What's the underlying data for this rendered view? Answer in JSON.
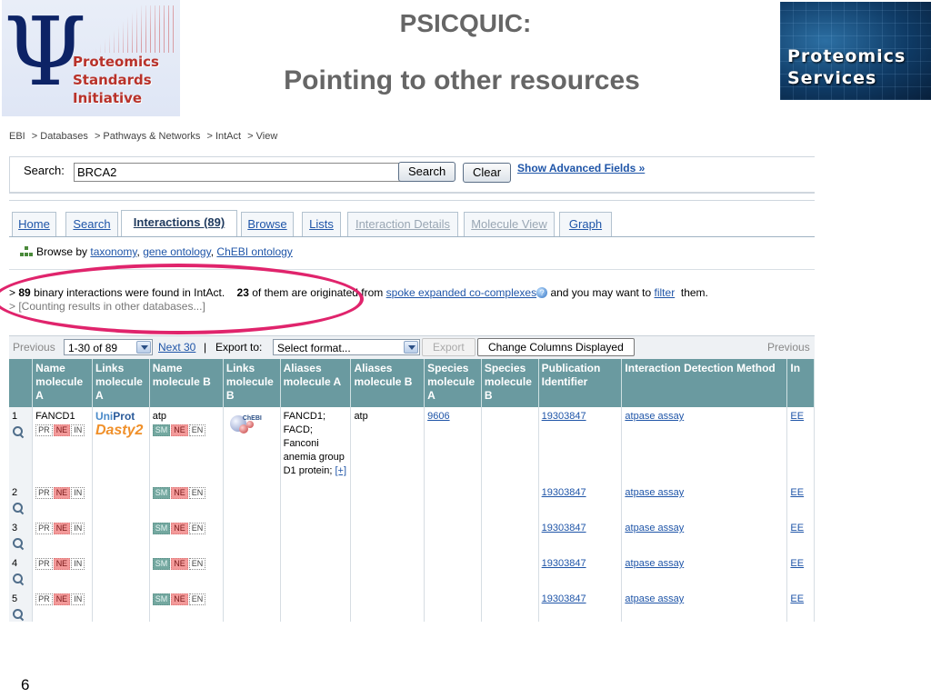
{
  "slide": {
    "title_line1": "PSICQUIC:",
    "title_line2": "Pointing to other resources",
    "number": "6",
    "logo_left_text": [
      "Proteomics",
      "Standards",
      "Initiative"
    ],
    "logo_left_symbol": "Ψ",
    "logo_right_text": [
      "Proteomics",
      "Services"
    ]
  },
  "breadcrumb": [
    "EBI",
    "> Databases",
    "> Pathways & Networks",
    "> IntAct",
    "> View"
  ],
  "search": {
    "label": "Search:",
    "value": "BRCA2",
    "search_button": "Search",
    "clear_button": "Clear",
    "advanced_link": "Show Advanced Fields »"
  },
  "tabs": [
    {
      "label": "Home"
    },
    {
      "label": "Search"
    },
    {
      "label": "Interactions (89)"
    },
    {
      "label": "Browse"
    },
    {
      "label": "Lists"
    },
    {
      "label": "Interaction Details"
    },
    {
      "label": "Molecule View"
    },
    {
      "label": "Graph"
    }
  ],
  "browse_by": {
    "prefix": "Browse by",
    "link1": "taxonomy",
    "sep1": ",",
    "link2": "gene ontology",
    "sep2": ",",
    "link3": "ChEBI ontology"
  },
  "info": {
    "gt": ">",
    "count": "89",
    "text1": "binary interactions were found in IntAct.",
    "count2": "23",
    "text2": "of them are originated from",
    "link_spoke": "spoke expanded co-complexes",
    "help_glyph": "?",
    "text3": "and you may want to",
    "link_filter": "filter",
    "text4": "them.",
    "line2": "> [Counting results in other databases...]"
  },
  "pager": {
    "previous": "Previous",
    "range": "1-30 of 89",
    "next": "Next 30",
    "sep": "|",
    "export_label": "Export to:",
    "export_select": "Select format...",
    "export_button": "Export",
    "change_columns": "Change Columns Displayed",
    "previous_right": "Previous"
  },
  "table": {
    "headers": [
      "",
      "Name molecule A",
      "Links molecule A",
      "Name molecule B",
      "Links molecule B",
      "Aliases molecule A",
      "Aliases molecule B",
      "Species molecule A",
      "Species molecule B",
      "Publication Identifier",
      "Interaction Detection Method",
      "In"
    ],
    "tags": {
      "pr": "PR",
      "ne": "NE",
      "in": "IN",
      "sm": "SM",
      "en": "EN"
    },
    "logos": {
      "uniprot_a": "Uni",
      "uniprot_b": "Prot",
      "dasty": "Dasty",
      "dasty_num": "2",
      "chebi": "ChEBI"
    },
    "rows": [
      {
        "num": "1",
        "name_a": "FANCD1",
        "name_b": "atp",
        "aliases_a": "FANCD1; FACD; Fanconi anemia group D1 protein;",
        "aliases_more": "[+]",
        "aliases_b": "atp",
        "species_a": "9606",
        "species_b": "",
        "pub": "19303847",
        "method": "atpase assay",
        "next": "EE"
      },
      {
        "num": "2",
        "name_a": "",
        "name_b": "",
        "aliases_a": "",
        "aliases_more": "",
        "aliases_b": "",
        "species_a": "",
        "species_b": "",
        "pub": "19303847",
        "method": "atpase assay",
        "next": "EE"
      },
      {
        "num": "3",
        "name_a": "",
        "name_b": "",
        "aliases_a": "",
        "aliases_more": "",
        "aliases_b": "",
        "species_a": "",
        "species_b": "",
        "pub": "19303847",
        "method": "atpase assay",
        "next": "EE"
      },
      {
        "num": "4",
        "name_a": "",
        "name_b": "",
        "aliases_a": "",
        "aliases_more": "",
        "aliases_b": "",
        "species_a": "",
        "species_b": "",
        "pub": "19303847",
        "method": "atpase assay",
        "next": "EE"
      },
      {
        "num": "5",
        "name_a": "",
        "name_b": "",
        "aliases_a": "",
        "aliases_more": "",
        "aliases_b": "",
        "species_a": "",
        "species_b": "",
        "pub": "19303847",
        "method": "atpase assay",
        "next": "EE"
      }
    ]
  },
  "colors": {
    "header_teal": "#6a9aa0",
    "link_blue": "#1f55a8",
    "highlight_ellipse": "#e0246c",
    "title_gray": "#666666"
  }
}
